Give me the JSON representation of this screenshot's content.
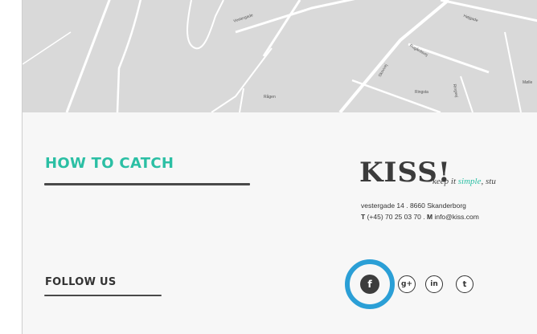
{
  "map": {
    "labels": [
      "Vestergade",
      "Højgade",
      "Rugårdsvej",
      "Rågen",
      "Ringsta",
      "Skovvej",
      "Ringvej",
      "Mølle"
    ]
  },
  "how_to_catch": {
    "title": "HOW TO CATCH"
  },
  "contact": {
    "logo": "KISS!",
    "tagline_prefix": "keep it ",
    "tagline_accent": "simple",
    "tagline_suffix": ", stu",
    "address_line": "vestergade 14 . 8660 Skanderborg",
    "phone_label": "T",
    "phone": " (+45) 70 25 03 70 . ",
    "email_label": "M",
    "email": " info@kiss.com"
  },
  "follow_us": {
    "title": "FOLLOW US",
    "icons": [
      {
        "name": "facebook-icon",
        "glyph": "f"
      },
      {
        "name": "google-plus-icon",
        "glyph": "g+"
      },
      {
        "name": "linkedin-icon",
        "glyph": "in"
      },
      {
        "name": "twitter-icon",
        "glyph": "t"
      }
    ]
  },
  "colors": {
    "accent": "#2bbfa4",
    "highlight": "#2b9fd6",
    "text": "#333333",
    "map_bg": "#d9d9d9"
  }
}
